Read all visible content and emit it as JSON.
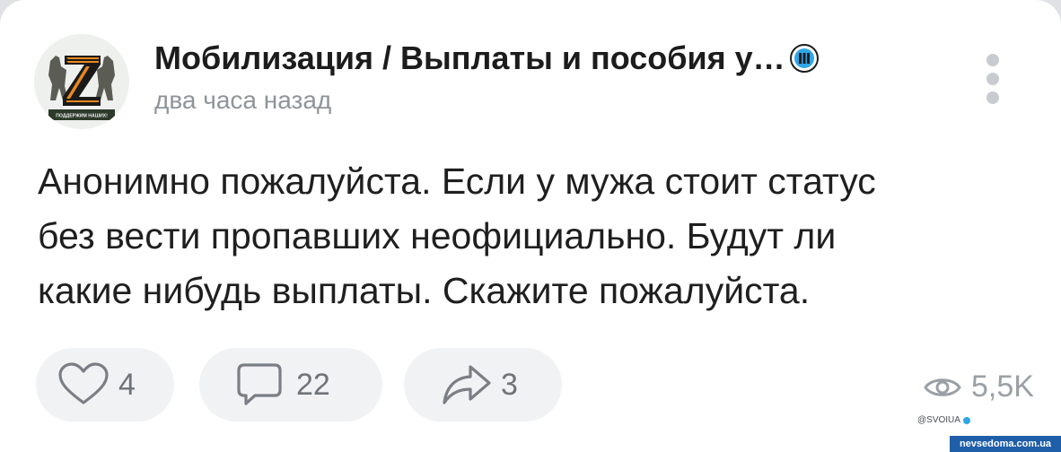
{
  "post": {
    "channel_name": "Мобилизация / Выплаты и пособия у…",
    "timestamp": "два часа назад",
    "avatar_text": "ПОДДЕРЖИМ НАШИХ!",
    "text_lines": [
      "Анонимно пожалуйста. Если у мужа стоит статус",
      "без вести пропавших неофициально. Будут ли",
      "какие нибудь выплаты. Скажите пожалуйста."
    ]
  },
  "actions": {
    "likes": "4",
    "comments": "22",
    "shares": "3",
    "views": "5,5K"
  },
  "icons": {
    "avatar": "z-emblem-avatar",
    "verified": "verified-badge-icon",
    "more": "more-vertical-icon",
    "like": "heart-icon",
    "comment": "comment-bubble-icon",
    "share": "share-arrow-icon",
    "views": "eye-icon"
  },
  "overlay": {
    "handle": "@SVOIUA",
    "watermark": "nevsedoma.com.ua"
  },
  "colors": {
    "background": "#ffffff",
    "text": "#1f1f1f",
    "muted": "#8e949a",
    "pill": "#f1f2f4",
    "z_orange": "#e8891c",
    "z_black": "#1a1a1a",
    "watermark_bg": "#1f5ea8"
  }
}
